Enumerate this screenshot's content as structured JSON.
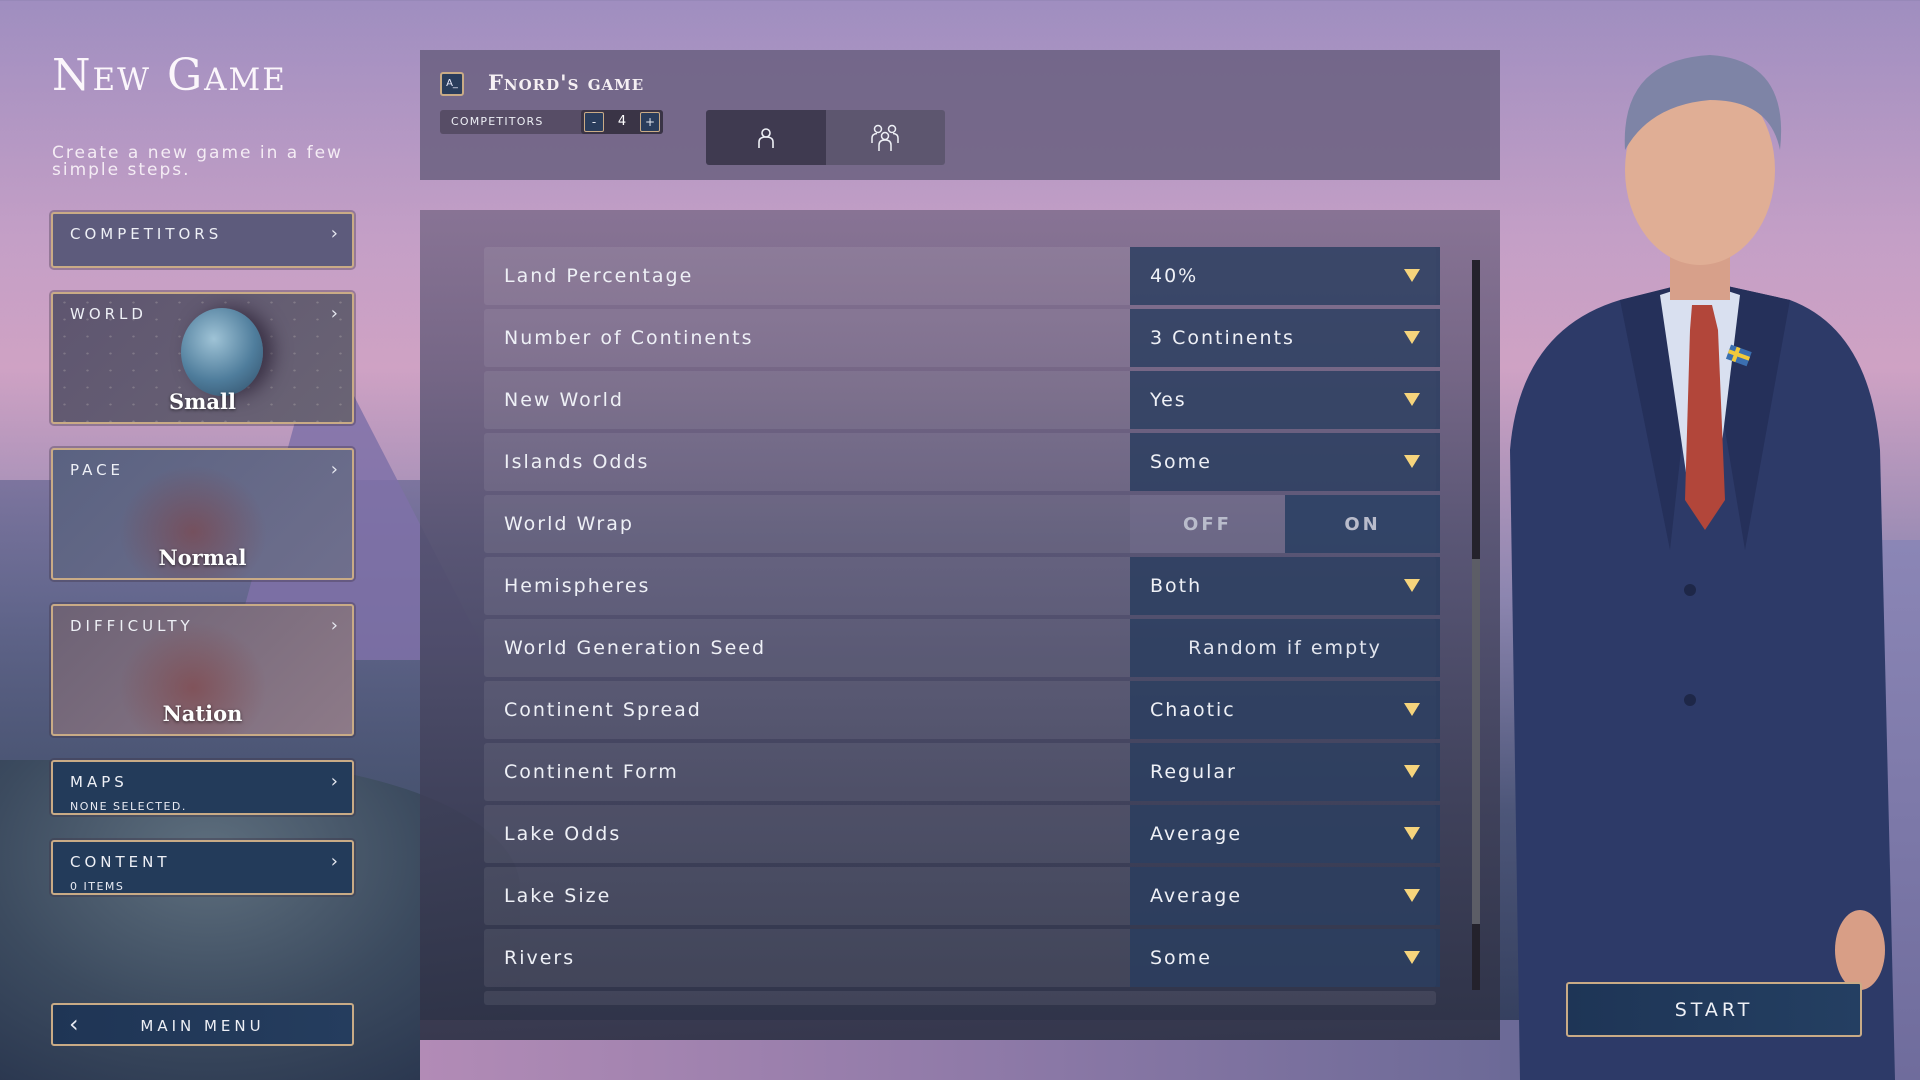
{
  "left_panel": {
    "title": "New Game",
    "subtitle": "Create a new game in a few simple steps.",
    "cards": {
      "competitors": {
        "label": "Competitors"
      },
      "world": {
        "label": "World",
        "value": "Small"
      },
      "pace": {
        "label": "Pace",
        "value": "Normal"
      },
      "difficulty": {
        "label": "Difficulty",
        "value": "Nation"
      },
      "maps": {
        "label": "Maps",
        "sub": "None selected."
      },
      "content": {
        "label": "Content",
        "sub": "0 items"
      }
    },
    "main_menu_label": "MAIN MENU",
    "chevron_right": "›",
    "chevron_left": "‹"
  },
  "header": {
    "console_icon_text": "A_",
    "game_name": "Fnord's game",
    "competitors_label": "COMPETITORS",
    "competitors_count": "4",
    "minus": "-",
    "plus": "+",
    "mode_tabs": [
      {
        "name": "single-player",
        "selected": true
      },
      {
        "name": "multiplayer",
        "selected": false
      }
    ]
  },
  "settings": {
    "rows": [
      {
        "label": "Land Percentage",
        "type": "dropdown",
        "value": "40%"
      },
      {
        "label": "Number of Continents",
        "type": "dropdown",
        "value": "3 Continents"
      },
      {
        "label": "New World",
        "type": "dropdown",
        "value": "Yes"
      },
      {
        "label": "Islands Odds",
        "type": "dropdown",
        "value": "Some"
      },
      {
        "label": "World Wrap",
        "type": "toggle",
        "off_label": "OFF",
        "on_label": "ON",
        "value": "ON"
      },
      {
        "label": "Hemispheres",
        "type": "dropdown",
        "value": "Both"
      },
      {
        "label": "World Generation Seed",
        "type": "input",
        "value": "",
        "placeholder": "Random if empty"
      },
      {
        "label": "Continent Spread",
        "type": "dropdown",
        "value": "Chaotic"
      },
      {
        "label": "Continent Form",
        "type": "dropdown",
        "value": "Regular"
      },
      {
        "label": "Lake Odds",
        "type": "dropdown",
        "value": "Average"
      },
      {
        "label": "Lake Size",
        "type": "dropdown",
        "value": "Average"
      },
      {
        "label": "Rivers",
        "type": "dropdown",
        "value": "Some"
      }
    ],
    "scroll": {
      "thumb_start_fraction": 0.41,
      "thumb_end_fraction": 0.91
    }
  },
  "start_label": "START",
  "colors": {
    "accent_gold": "#c9ab86",
    "dropdown_arrow": "#f6d47c",
    "control_blue": "#283c5e"
  }
}
